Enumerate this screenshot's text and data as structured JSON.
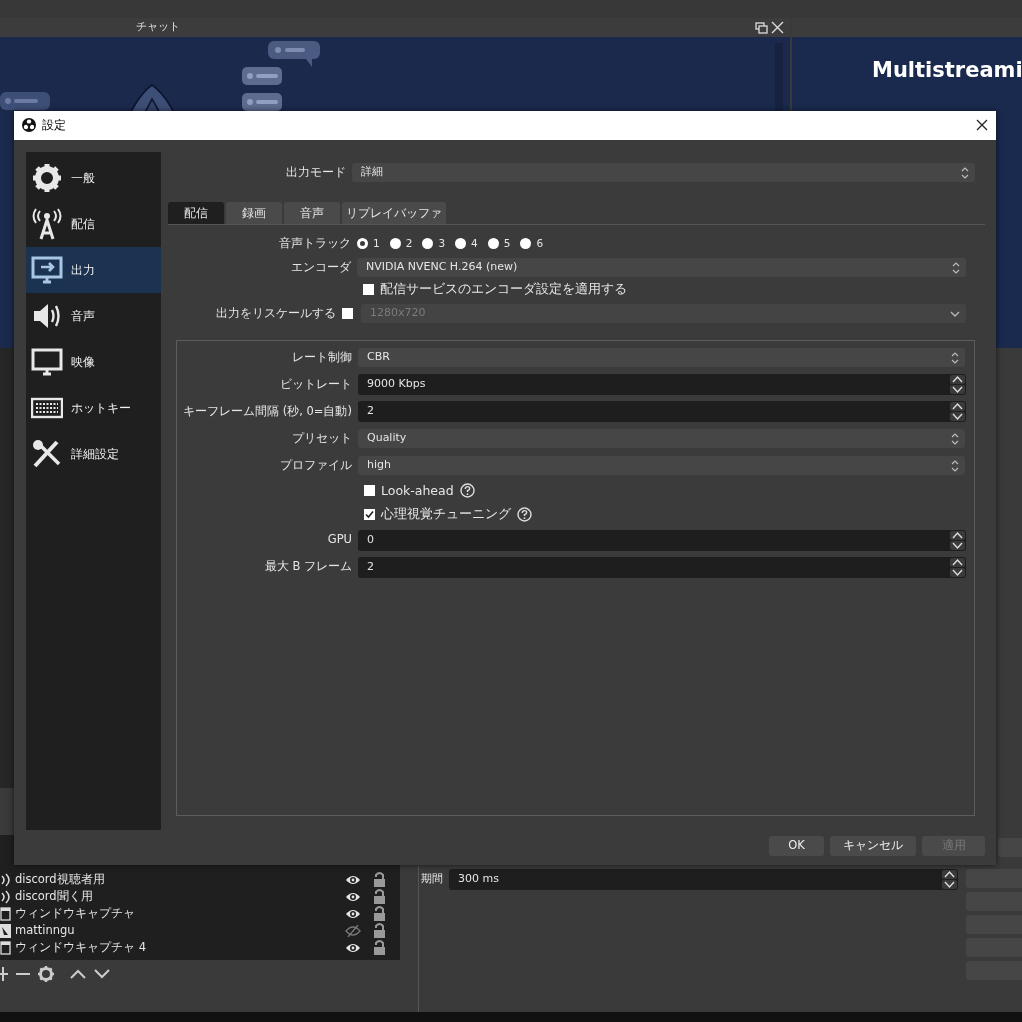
{
  "main_window": {
    "chat_dock": {
      "title": "チャット"
    },
    "multistream_dock": {
      "heading": "Multistreami"
    },
    "sources": [
      {
        "kind": "audio",
        "name": "discord視聴者用",
        "visible": true,
        "locked": false
      },
      {
        "kind": "audio",
        "name": "discord聞く用",
        "visible": true,
        "locked": false
      },
      {
        "kind": "window",
        "name": "ウィンドウキャプチャ",
        "visible": true,
        "locked": false
      },
      {
        "kind": "image",
        "name": "mattinngu",
        "visible": false,
        "locked": false
      },
      {
        "kind": "window",
        "name": "ウィンドウキャプチャ 4",
        "visible": true,
        "locked": false
      }
    ],
    "filter_field": {
      "label": "期間",
      "value": "300 ms"
    }
  },
  "settings_dialog": {
    "title": "設定",
    "sidebar": [
      {
        "label": "一般",
        "selected": false
      },
      {
        "label": "配信",
        "selected": false
      },
      {
        "label": "出力",
        "selected": true
      },
      {
        "label": "音声",
        "selected": false
      },
      {
        "label": "映像",
        "selected": false
      },
      {
        "label": "ホットキー",
        "selected": false
      },
      {
        "label": "詳細設定",
        "selected": false
      }
    ],
    "output_mode": {
      "label": "出力モード",
      "value": "詳細"
    },
    "tabs": [
      {
        "label": "配信",
        "selected": true
      },
      {
        "label": "録画",
        "selected": false
      },
      {
        "label": "音声",
        "selected": false
      },
      {
        "label": "リプレイバッファ",
        "selected": false
      }
    ],
    "audio_track": {
      "label": "音声トラック",
      "options": [
        {
          "label": "1",
          "selected": true
        },
        {
          "label": "2",
          "selected": false
        },
        {
          "label": "3",
          "selected": false
        },
        {
          "label": "4",
          "selected": false
        },
        {
          "label": "5",
          "selected": false
        },
        {
          "label": "6",
          "selected": false
        }
      ]
    },
    "encoder": {
      "label": "エンコーダ",
      "value": "NVIDIA NVENC H.264 (new)"
    },
    "apply_service_settings": {
      "label": "配信サービスのエンコーダ設定を適用する",
      "checked": false
    },
    "rescale": {
      "label": "出力をリスケールする",
      "checked": false,
      "value": "1280x720",
      "disabled": true
    },
    "encoder_settings": [
      {
        "kind": "select",
        "label": "レート制御",
        "value": "CBR"
      },
      {
        "kind": "spin",
        "label": "ビットレート",
        "value": "9000 Kbps"
      },
      {
        "kind": "spin",
        "label": "キーフレーム間隔 (秒, 0=自動)",
        "value": "2"
      },
      {
        "kind": "select",
        "label": "プリセット",
        "value": "Quality"
      },
      {
        "kind": "select",
        "label": "プロファイル",
        "value": "high"
      },
      {
        "kind": "checkbox",
        "label": "Look-ahead",
        "checked": false
      },
      {
        "kind": "checkbox",
        "label": "心理視覚チューニング",
        "checked": true
      },
      {
        "kind": "spin",
        "label": "GPU",
        "value": "0"
      },
      {
        "kind": "spin",
        "label": "最大 B フレーム",
        "value": "2"
      }
    ],
    "buttons": [
      {
        "label": "OK",
        "disabled": false
      },
      {
        "label": "キャンセル",
        "disabled": false
      },
      {
        "label": "適用",
        "disabled": true
      }
    ]
  }
}
